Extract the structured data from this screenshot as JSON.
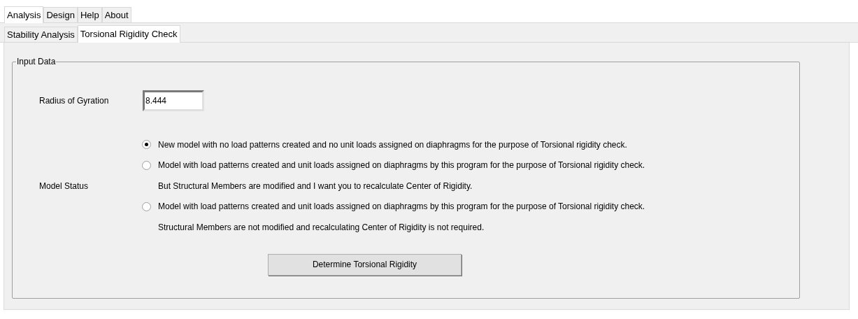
{
  "main_tabs": [
    {
      "label": "Analysis",
      "selected": true
    },
    {
      "label": "Design",
      "selected": false
    },
    {
      "label": "Help",
      "selected": false
    },
    {
      "label": "About",
      "selected": false
    }
  ],
  "sub_tabs": [
    {
      "label": "Stability Analysis",
      "selected": false
    },
    {
      "label": "Torsional Rigidity Check",
      "selected": true
    }
  ],
  "group": {
    "title": "Input Data",
    "radius_label": "Radius of Gyration",
    "radius_value": "8.444",
    "model_status_label": "Model Status",
    "options": [
      {
        "lines": [
          "New model with no load patterns created and no unit loads assigned on diaphragms for the purpose of Torsional rigidity check."
        ],
        "selected": true
      },
      {
        "lines": [
          "Model with load patterns created and unit loads assigned on diaphragms by this program for the purpose of Torsional rigidity check.",
          "But Structural Members are modified and I want you to recalculate Center of Rigidity."
        ],
        "selected": false
      },
      {
        "lines": [
          "Model with load patterns created and unit loads assigned on diaphragms by this program for the purpose of Torsional rigidity check.",
          "Structural Members are not modified and recalculating Center of Rigidity is not required."
        ],
        "selected": false
      }
    ],
    "button": "Determine Torsional Rigidity"
  }
}
